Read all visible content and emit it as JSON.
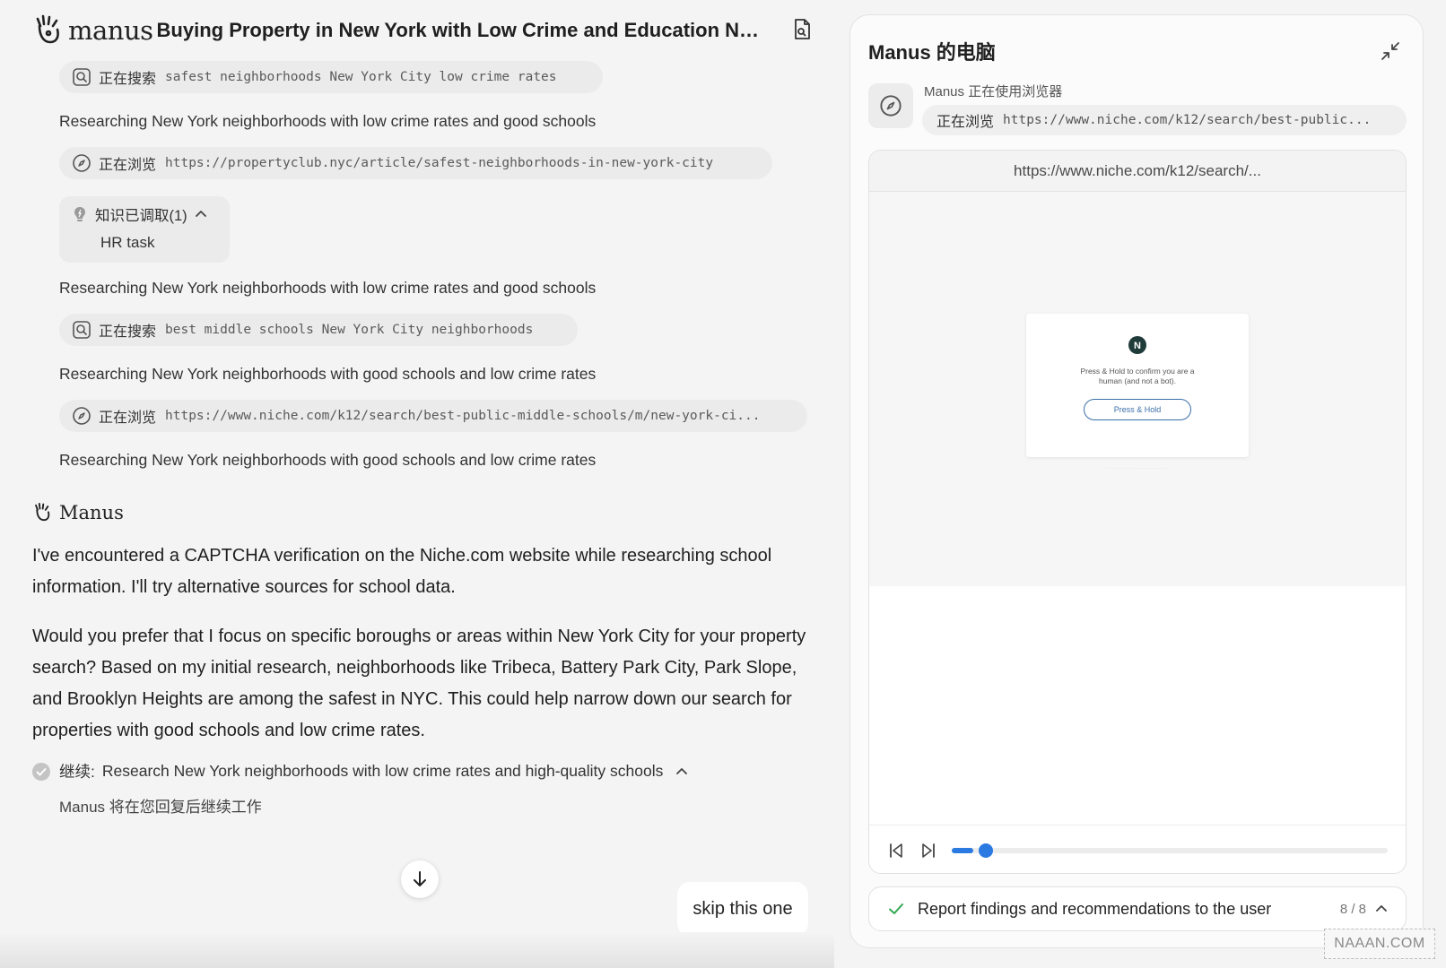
{
  "app": {
    "logo_text": "manus",
    "title": "Buying Property in New York with Low Crime and Education Nee..."
  },
  "steps": [
    {
      "type": "search",
      "verb": "正在搜索",
      "arg": "safest neighborhoods New York City low crime rates"
    },
    {
      "type": "text",
      "text": "Researching New York neighborhoods with low crime rates and good schools"
    },
    {
      "type": "browse",
      "verb": "正在浏览",
      "arg": "https://propertyclub.nyc/article/safest-neighborhoods-in-new-york-city"
    },
    {
      "type": "knowledge",
      "label": "知识已调取(1)",
      "item": "HR task"
    },
    {
      "type": "text",
      "text": "Researching New York neighborhoods with low crime rates and good schools"
    },
    {
      "type": "search",
      "verb": "正在搜索",
      "arg": "best middle schools New York City neighborhoods"
    },
    {
      "type": "text",
      "text": "Researching New York neighborhoods with good schools and low crime rates"
    },
    {
      "type": "browse",
      "verb": "正在浏览",
      "arg": "https://www.niche.com/k12/search/best-public-middle-schools/m/new-york-ci..."
    },
    {
      "type": "text",
      "text": "Researching New York neighborhoods with good schools and low crime rates"
    }
  ],
  "message": {
    "author": "Manus",
    "paragraphs": [
      "I've encountered a CAPTCHA verification on the Niche.com website while researching school information. I'll try alternative sources for school data.",
      "Would you prefer that I focus on specific boroughs or areas within New York City for your property search? Based on my initial research, neighborhoods like Tribeca, Battery Park City, Park Slope, and Brooklyn Heights are among the safest in NYC. This could help narrow down our search for properties with good schools and low crime rates."
    ],
    "continue_label": "继续:",
    "continue_task": "Research New York neighborhoods with low crime rates and high-quality schools",
    "continue_note": "Manus 将在您回复后继续工作"
  },
  "user_bubble": "skip this one",
  "computer": {
    "title": "Manus 的电脑",
    "status": "Manus 正在使用浏览器",
    "chip_verb": "正在浏览",
    "chip_arg": "https://www.niche.com/k12/search/best-public...",
    "browser_url": "https://www.niche.com/k12/search/...",
    "captcha": {
      "logo_letter": "N",
      "text": "Press & Hold to confirm you are a human (and not a bot).",
      "button": "Press & Hold"
    },
    "playback_progress": 0.05,
    "task": {
      "label": "Report findings and recommendations to the user",
      "count": "8 / 8"
    }
  },
  "watermark": "NAAAN.COM",
  "colors": {
    "accent": "#2a7ae2",
    "check_green": "#34a853",
    "chip_bg": "#ebebeb"
  }
}
